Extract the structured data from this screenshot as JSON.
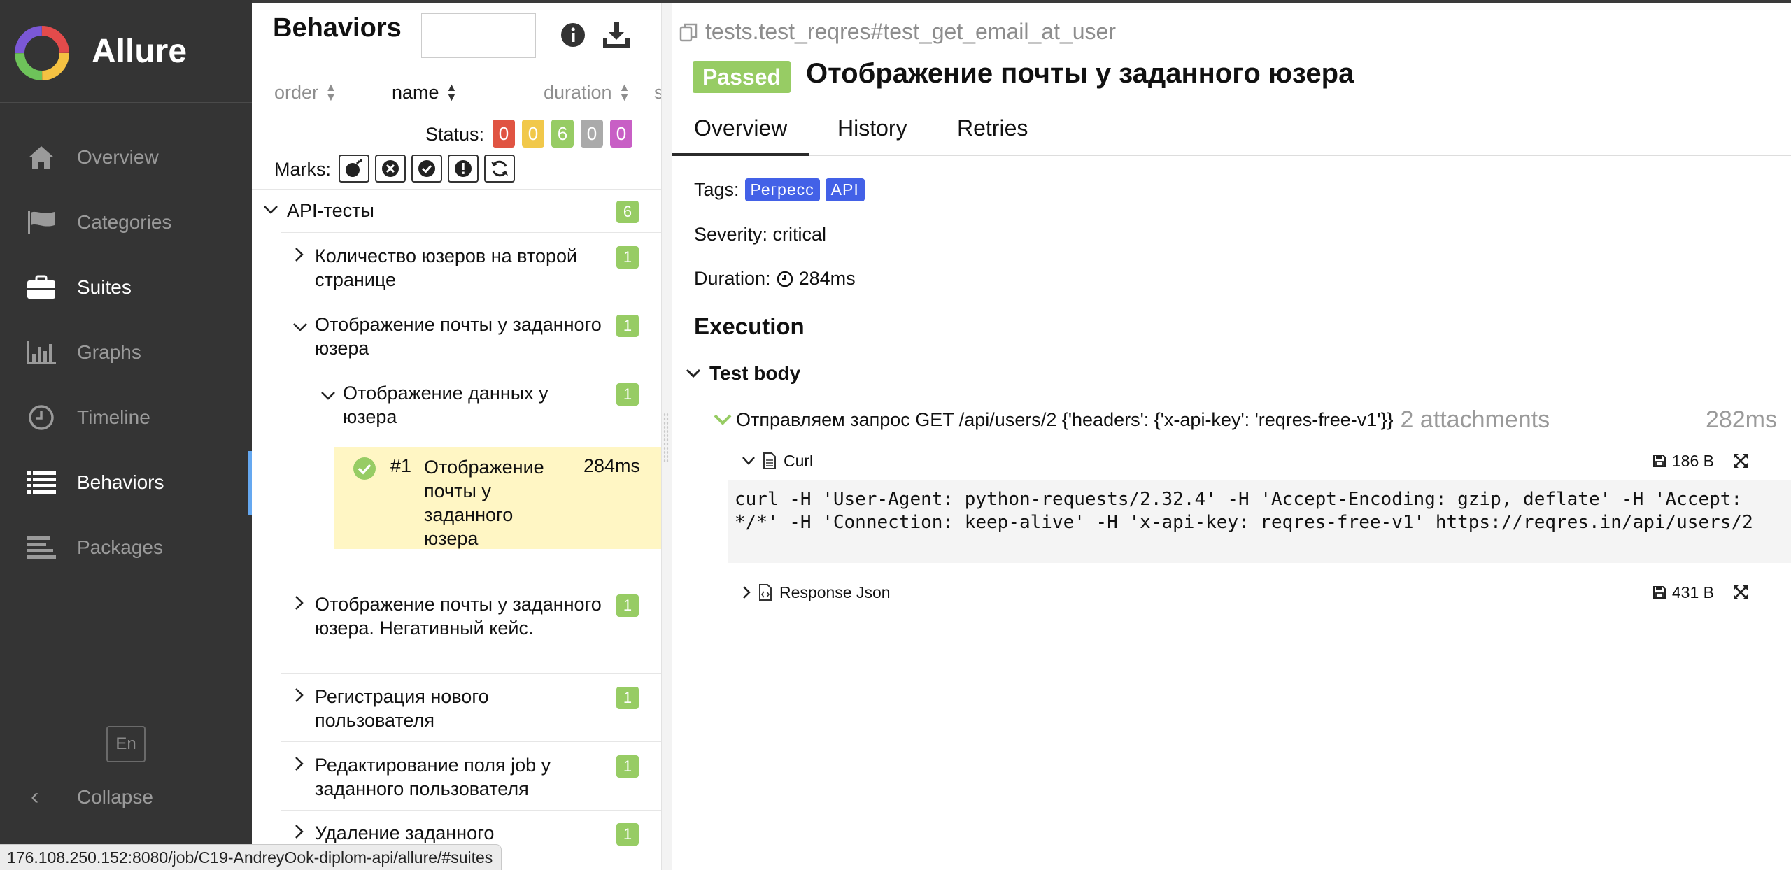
{
  "app": {
    "name": "Allure"
  },
  "sidebar": {
    "items": [
      {
        "label": "Overview",
        "icon": "home-icon"
      },
      {
        "label": "Categories",
        "icon": "flag-icon"
      },
      {
        "label": "Suites",
        "icon": "briefcase-icon"
      },
      {
        "label": "Graphs",
        "icon": "bar-chart-icon"
      },
      {
        "label": "Timeline",
        "icon": "clock-icon"
      },
      {
        "label": "Behaviors",
        "icon": "list-icon"
      },
      {
        "label": "Packages",
        "icon": "align-left-icon"
      }
    ],
    "language": "En",
    "collapse": "Collapse"
  },
  "tree": {
    "title": "Behaviors",
    "search_value": "",
    "sort": {
      "order": "order",
      "name": "name",
      "duration": "duration",
      "status": "s"
    },
    "status_label": "Status:",
    "status_counts": [
      {
        "value": "0",
        "color": "#e05442"
      },
      {
        "value": "0",
        "color": "#f1c84a"
      },
      {
        "value": "6",
        "color": "#97cc64"
      },
      {
        "value": "0",
        "color": "#aaaaaa"
      },
      {
        "value": "0",
        "color": "#c85fc5"
      }
    ],
    "marks_label": "Marks:",
    "root": {
      "name": "API-тесты",
      "count": "6"
    },
    "nodes": [
      {
        "name": "Количество юзеров на второй странице",
        "count": "1"
      },
      {
        "name": "Отображение почты у заданного юзера",
        "count": "1"
      },
      {
        "name": "Отображение данных у юзера",
        "count": "1"
      },
      {
        "name": "Отображение почты у заданного юзера. Негативный кейс.",
        "count": "1"
      },
      {
        "name": "Регистрация нового пользователя",
        "count": "1"
      },
      {
        "name": "Редактирование поля job у заданного пользователя",
        "count": "1"
      },
      {
        "name": "Удаление заданного",
        "count": "1"
      }
    ],
    "leaf": {
      "num": "#1",
      "name": "Отображение почты у заданного юзера",
      "time": "284ms"
    }
  },
  "detail": {
    "breadcrumb": "tests.test_reqres#test_get_email_at_user",
    "status": "Passed",
    "title": "Отображение почты у заданного юзера",
    "tabs": [
      "Overview",
      "History",
      "Retries"
    ],
    "tags_label": "Tags:",
    "tags": [
      "Регресс",
      "API"
    ],
    "severity": "Severity: critical",
    "duration_label": "Duration:",
    "duration_value": "284ms",
    "execution": "Execution",
    "test_body": "Test body",
    "step": {
      "name": "Отправляем запрос GET /api/users/2 {'headers': {'x-api-key': 'reqres-free-v1'}}",
      "attachments": "2 attachments",
      "duration": "282ms"
    },
    "attachments": [
      {
        "name": "Curl",
        "size": "186 B"
      },
      {
        "name": "Response Json",
        "size": "431 B"
      }
    ],
    "curl_content": "curl -H 'User-Agent: python-requests/2.32.4' -H 'Accept-Encoding: gzip, deflate' -H 'Accept: */*' -H 'Connection: keep-alive' -H 'x-api-key: reqres-free-v1' https://reqres.in/api/users/2"
  },
  "statusbar": {
    "url": "176.108.250.152:8080/job/C19-AndreyOok-diplom-api/allure/#suites"
  }
}
